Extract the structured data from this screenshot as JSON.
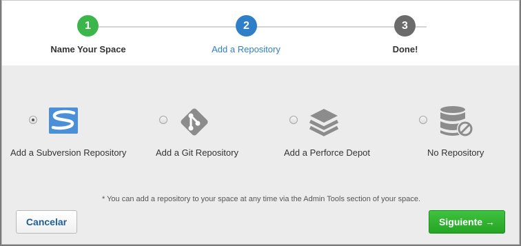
{
  "wizard": {
    "steps": [
      {
        "number": "1",
        "label": "Name Your Space",
        "state": "done",
        "color": "#3cb54a"
      },
      {
        "number": "2",
        "label": "Add a Repository",
        "state": "active",
        "color": "#2f7fc8"
      },
      {
        "number": "3",
        "label": "Done!",
        "state": "todo",
        "color": "#6b6b6b"
      }
    ]
  },
  "options": [
    {
      "label": "Add a Subversion Repository",
      "icon": "subversion-icon",
      "checked": true
    },
    {
      "label": "Add a Git Repository",
      "icon": "git-icon",
      "checked": false
    },
    {
      "label": "Add a Perforce Depot",
      "icon": "perforce-icon",
      "checked": false
    },
    {
      "label": "No Repository",
      "icon": "no-repository-icon",
      "checked": false
    }
  ],
  "note": "* You can add a repository to your space at any time via the Admin Tools section of your space.",
  "buttons": {
    "cancel_label": "Cancelar",
    "next_label": "Siguiente →"
  }
}
